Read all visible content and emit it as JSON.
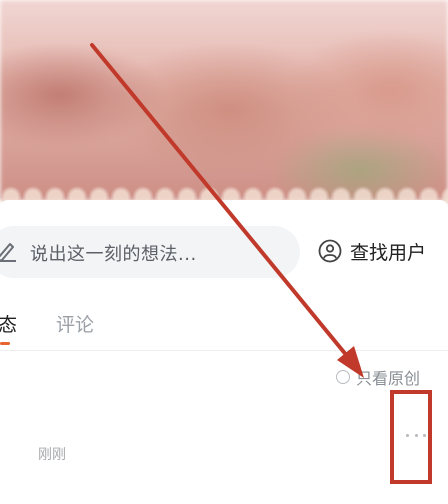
{
  "composer": {
    "placeholder": "说出这一刻的想法..."
  },
  "header": {
    "find_user_label": "查找用户"
  },
  "tabs": [
    {
      "label": "态",
      "active": true
    },
    {
      "label": "评论",
      "active": false
    }
  ],
  "filter": {
    "original_only_label": "只看原创",
    "checked": false
  },
  "post": {
    "time": "刚刚"
  },
  "icons": {
    "composer": "pencil-icon",
    "find_user": "user-search-icon",
    "more": "more-dots-icon"
  },
  "colors": {
    "accent": "#e8632f",
    "annotation": "#c0392b",
    "composer_bg": "#f3f4f6"
  }
}
